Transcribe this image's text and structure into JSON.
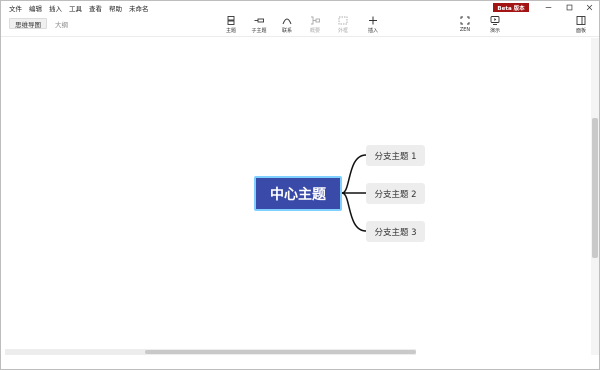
{
  "menu": [
    "文件",
    "编辑",
    "插入",
    "工具",
    "查看",
    "帮助",
    "未命名"
  ],
  "badge": "Beta 版本",
  "view_tabs": {
    "mindmap": "思维导图",
    "outline": "大纲"
  },
  "toolbar": {
    "topic": "主题",
    "subtopic": "子主题",
    "relationship": "联系",
    "summary": "概要",
    "boundary": "外框",
    "insert": "插入",
    "zen": "ZEN",
    "present": "演示",
    "panel": "面板"
  },
  "map": {
    "central": "中心主题",
    "branches": [
      "分支主题 1",
      "分支主题 2",
      "分支主题 3"
    ]
  },
  "colors": {
    "central_fill": "#3a4aa8",
    "central_border": "#7fd0ff",
    "branch_fill": "#ededed",
    "badge": "#a31515"
  }
}
